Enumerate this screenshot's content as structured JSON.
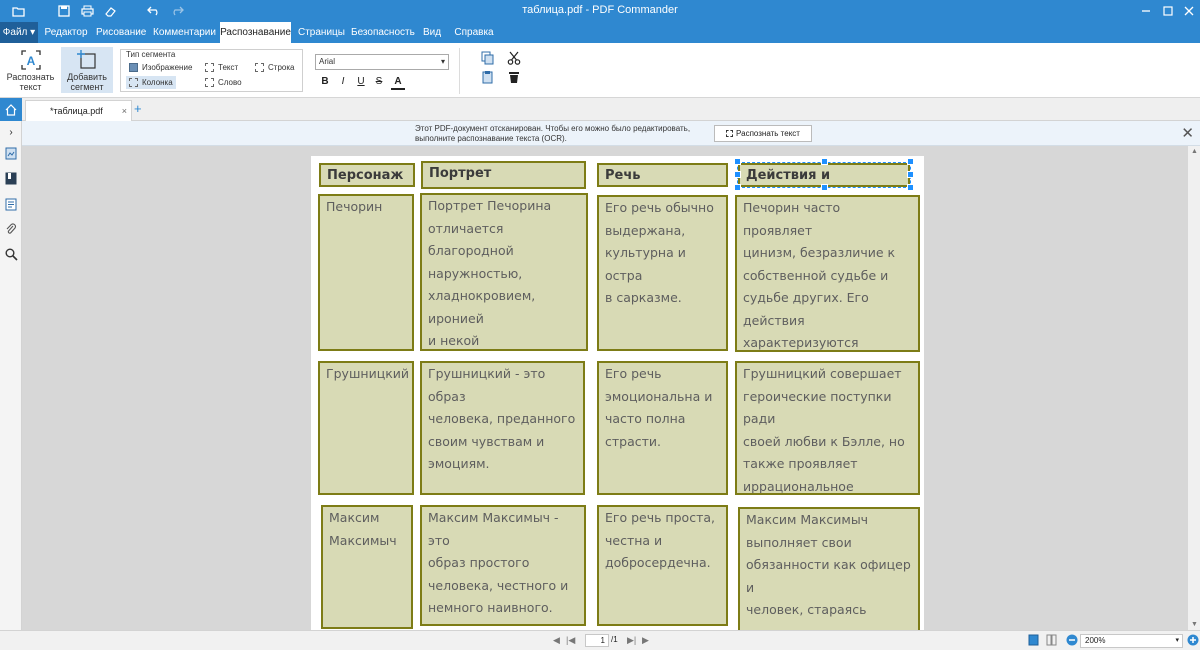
{
  "window": {
    "title": "таблица.pdf - PDF Commander"
  },
  "menu": {
    "file": "Файл",
    "items": [
      "Редактор",
      "Рисование",
      "Комментарии",
      "Распознавание",
      "Страницы",
      "Безопасность",
      "Вид",
      "Справка"
    ],
    "active": "Распознавание"
  },
  "ribbon": {
    "recognize_text": "Распознать\nтекст",
    "add_segment": "Добавить\nсегмент",
    "segment_type_title": "Тип сегмента",
    "segment_types": {
      "image": "Изображение",
      "text": "Текст",
      "line": "Строка",
      "column": "Колонка",
      "word": "Слово"
    },
    "font": "Arial",
    "format": {
      "bold": "B",
      "italic": "I",
      "underline": "U",
      "strike": "S",
      "color": "A"
    }
  },
  "tabs": {
    "doc": "*таблица.pdf",
    "close": "×",
    "add": "+"
  },
  "banner": {
    "message_line1": "Этот PDF-документ отсканирован. Чтобы его можно было редактировать,",
    "message_line2": "выполните распознавание текста (OCR).",
    "button": "Распознать текст",
    "close": "✕"
  },
  "table": {
    "headers": [
      "Персонаж",
      "Портрет",
      "Речь",
      "Действия и поступки"
    ],
    "rows": [
      {
        "character": "Печорин",
        "portrait": "Портрет Печорина\nотличается благородной\nнаружностью,\nхладнокровием, иронией\nи некой отчужденностью\nот окружающего мира.",
        "speech": "Его речь обычно\nвыдержана,\nкультурна и остра\nв сарказме.",
        "actions": "Печорин часто проявляет\nцинизм, безразличие к\nсобственной судьбе и\nсудьбе других. Его действия\nхарактеризуются желанием\nуйти от реальности и\nпоиска приключений."
      },
      {
        "character": "Грушницкий",
        "portrait": "Грушницкий - это образ\nчеловека, преданного\nсвоим чувствам и\nэмоциям.",
        "speech": "Его речь\nэмоциональна и\nчасто полна\nстрасти.",
        "actions": "Грушницкий совершает\nгероические поступки ради\nсвоей любви к Бэлле, но\nтакже проявляет\nиррациональное\nревностью и зависть."
      },
      {
        "character": "Максим\nМаксимыч",
        "portrait": "Максим Максимыч - это\nобраз простого\nчеловека, честного и\nнемного наивного.",
        "speech": "Его речь проста,\nчестна и\nдобросердечна.",
        "actions": "Максим Максимыч\nвыполняет свои\nобязанности как офицер и\nчеловек, стараясь\nсправедливо и честно. Он\nтакже проявляет симпатию"
      }
    ]
  },
  "status": {
    "page": "1",
    "total": "/1",
    "zoom": "200%"
  },
  "colors": {
    "accent": "#2f88d0",
    "cell_fill": "#d8dab5",
    "cell_border": "#7d7c16",
    "handle": "#1e90ff"
  }
}
